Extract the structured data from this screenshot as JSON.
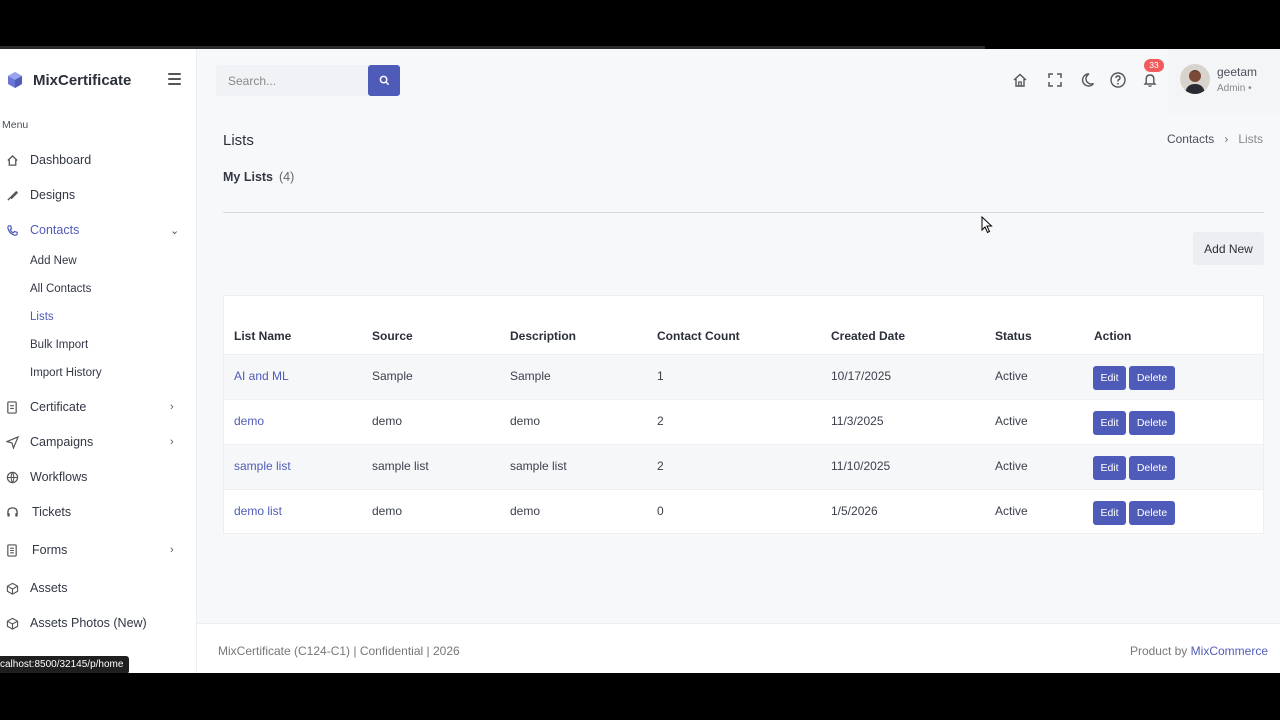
{
  "brand": {
    "name": "MixCertificate",
    "accent": "#4f5bb8"
  },
  "sidebar": {
    "menu_title": "Menu",
    "items": [
      {
        "label": "Dashboard",
        "icon": "home-icon"
      },
      {
        "label": "Designs",
        "icon": "brush-icon"
      },
      {
        "label": "Contacts",
        "icon": "phone-icon",
        "expanded": true
      },
      {
        "label": "Certificate",
        "icon": "document-icon"
      },
      {
        "label": "Campaigns",
        "icon": "send-icon"
      },
      {
        "label": "Workflows",
        "icon": "globe-icon"
      },
      {
        "label": "Tickets",
        "icon": "headset-icon"
      },
      {
        "label": "Forms",
        "icon": "form-icon"
      },
      {
        "label": "Assets",
        "icon": "box-icon"
      },
      {
        "label": "Assets Photos (New)",
        "icon": "box-icon"
      }
    ],
    "contacts_sub": [
      "Add New",
      "All Contacts",
      "Lists",
      "Bulk Import",
      "Import History"
    ]
  },
  "header": {
    "search_placeholder": "Search...",
    "notification_count": "33",
    "user_name": "geetam",
    "user_role": "Admin •"
  },
  "page": {
    "title": "Lists",
    "breadcrumb": [
      "Contacts",
      "Lists"
    ],
    "section_label": "My Lists",
    "section_count": "(4)",
    "add_new_label": "Add New"
  },
  "table": {
    "headers": [
      "List Name",
      "Source",
      "Description",
      "Contact Count",
      "Created Date",
      "Status",
      "Action"
    ],
    "rows": [
      {
        "name": "AI and ML",
        "source": "Sample",
        "description": "Sample",
        "count": "1",
        "created": "10/17/2025",
        "status": "Active"
      },
      {
        "name": "demo",
        "source": "demo",
        "description": "demo",
        "count": "2",
        "created": "11/3/2025",
        "status": "Active"
      },
      {
        "name": "sample list",
        "source": "sample list",
        "description": "sample list",
        "count": "2",
        "created": "11/10/2025",
        "status": "Active"
      },
      {
        "name": "demo list",
        "source": "demo",
        "description": "demo",
        "count": "0",
        "created": "1/5/2026",
        "status": "Active"
      }
    ],
    "edit_label": "Edit",
    "delete_label": "Delete"
  },
  "footer": {
    "left": "MixCertificate (C124-C1) | Confidential | 2026",
    "right_prefix": "Product by",
    "right_brand": "MixCommerce"
  },
  "statusbar_url": "calhost:8500/32145/p/home"
}
